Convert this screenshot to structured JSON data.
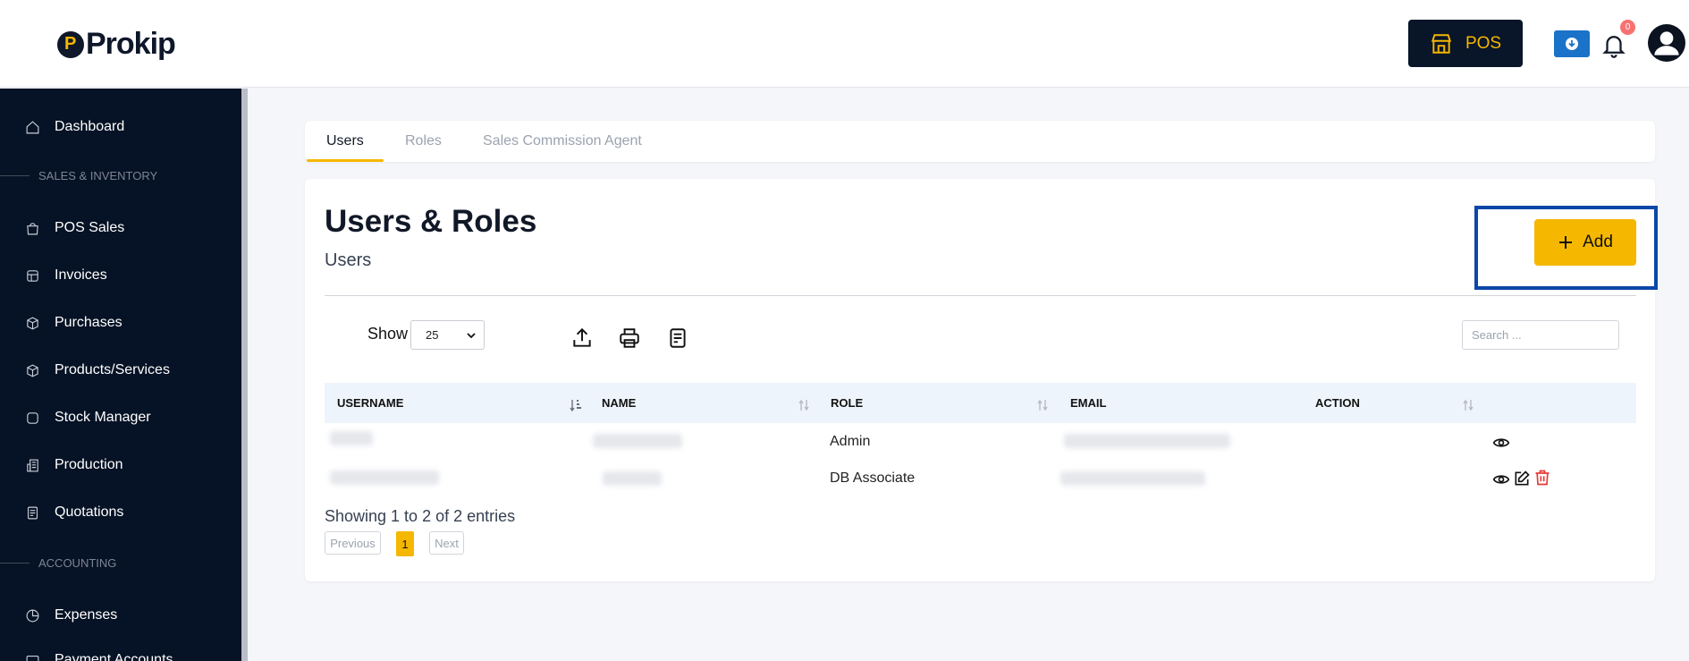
{
  "header": {
    "logo_text": "Prokip",
    "pos_label": "POS",
    "notification_count": "0",
    "icons": [
      "store-icon",
      "download-icon",
      "bell-icon",
      "user-avatar-icon"
    ]
  },
  "sidebar": {
    "items": [
      {
        "label": "Dashboard",
        "icon": "home-icon"
      },
      {
        "label": "POS Sales",
        "icon": "shopping-bag-icon"
      },
      {
        "label": "Invoices",
        "icon": "invoice-icon"
      },
      {
        "label": "Purchases",
        "icon": "package-icon"
      },
      {
        "label": "Products/Services",
        "icon": "cube-icon"
      },
      {
        "label": "Stock Manager",
        "icon": "stock-icon"
      },
      {
        "label": "Production",
        "icon": "building-icon"
      },
      {
        "label": "Quotations",
        "icon": "quotation-icon"
      },
      {
        "label": "Expenses",
        "icon": "pie-chart-icon"
      },
      {
        "label": "Payment Accounts",
        "icon": "wallet-icon"
      }
    ],
    "sections": [
      "SALES & INVENTORY",
      "ACCOUNTING"
    ]
  },
  "tabs": [
    "Users",
    "Roles",
    "Sales Commission Agent"
  ],
  "page": {
    "title": "Users & Roles",
    "subtitle": "Users",
    "add_label": "Add"
  },
  "controls": {
    "show_label": "Show",
    "page_size": "25",
    "search_placeholder": "Search ..."
  },
  "table": {
    "headers": [
      "USERNAME",
      "NAME",
      "ROLE",
      "EMAIL",
      "ACTION"
    ],
    "rows": [
      {
        "role": "Admin",
        "actions": [
          "view-icon"
        ]
      },
      {
        "role": "DB Associate",
        "actions": [
          "view-icon",
          "edit-icon",
          "delete-icon"
        ]
      }
    ]
  },
  "pagination": {
    "info": "Showing 1 to 2 of 2 entries",
    "previous": "Previous",
    "current": "1",
    "next": "Next"
  },
  "colors": {
    "brand_dark": "#061225",
    "accent": "#f5b700",
    "highlight_border": "#0a47a8",
    "download_button": "#1a73c8",
    "delete": "#e53935"
  }
}
